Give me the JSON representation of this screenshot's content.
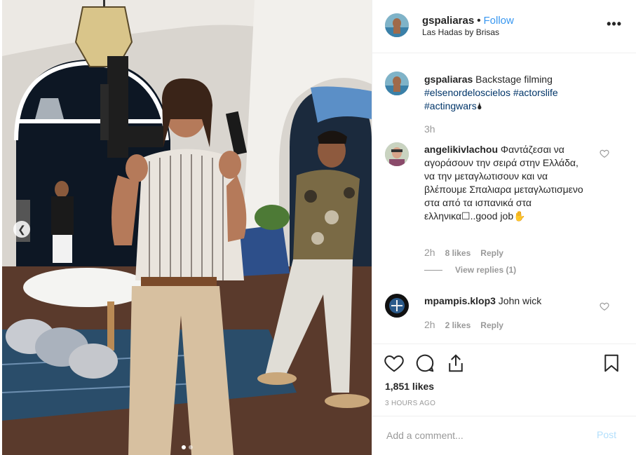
{
  "post": {
    "username": "gspaliaras",
    "separator": "•",
    "follow_label": "Follow",
    "location": "Las Hadas by Brisas",
    "more_label": "•••",
    "photo_alt": "Backstage filming photo",
    "carousel_dots": 2,
    "carousel_active": 0
  },
  "caption": {
    "username": "gspaliaras",
    "text": " Backstage filming ",
    "tags": [
      "#elsenordeloscielos",
      "#actorslife",
      "#actingwars"
    ],
    "emoji": "🌢",
    "time": "3h"
  },
  "comments": [
    {
      "username": "angelikivlachou",
      "text": " Φαντάζεσαι να αγοράσουν την σειρά στην Ελλάδα, να την μεταγλωτισουν και να βλέπουμε Σπαλιαρα μεταγλωτισμενο στα από τα ισπανικά στα ελληνικα☐..good job✋",
      "time": "2h",
      "likes": "8 likes",
      "reply_label": "Reply",
      "view_replies": "View replies (1)"
    },
    {
      "username": "mpampis.klop3",
      "text": " John wick",
      "time": "2h",
      "likes": "2 likes",
      "reply_label": "Reply"
    }
  ],
  "stats": {
    "likes": "1,851 likes",
    "time_ago": "3 HOURS AGO"
  },
  "composer": {
    "placeholder": "Add a comment...",
    "post_label": "Post"
  },
  "colors": {
    "link": "#3897f0",
    "hashtag": "#003569",
    "muted": "#999999",
    "post_disabled": "#b2dffc"
  }
}
